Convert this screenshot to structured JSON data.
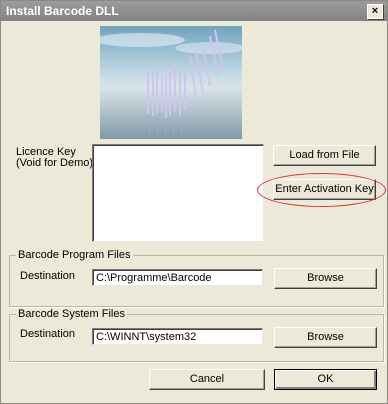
{
  "window": {
    "title": "Install Barcode DLL",
    "close_glyph": "×"
  },
  "licence": {
    "label_line1": "Licence Key",
    "label_line2": "(Void for Demo)",
    "value": ""
  },
  "buttons": {
    "load_from_file": "Load from File",
    "enter_activation_key": "Enter Activation Key",
    "browse": "Browse",
    "cancel": "Cancel",
    "ok": "OK"
  },
  "program_files": {
    "group_title": "Barcode Program Files",
    "destination_label": "Destination",
    "destination_value": "C:\\Programme\\Barcode"
  },
  "system_files": {
    "group_title": "Barcode System Files",
    "destination_label": "Destination",
    "destination_value": "C:\\WINNT\\system32"
  },
  "colors": {
    "highlight": "#e03030",
    "dialog_bg": "#ece9d8"
  }
}
